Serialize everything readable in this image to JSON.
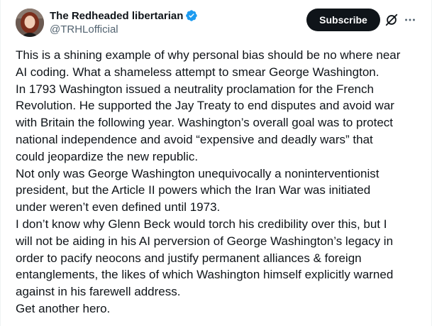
{
  "author": {
    "display_name": "The Redheaded libertarian",
    "handle": "@TRHLofficial",
    "verified": true,
    "avatar_icon": "profile-photo"
  },
  "actions": {
    "subscribe_label": "Subscribe",
    "grok_icon": "grok-slash-circle-icon",
    "more_icon": "ellipsis-icon"
  },
  "colors": {
    "verified_blue": "#1d9bf0",
    "text_primary": "#0f1419",
    "text_secondary": "#536471",
    "button_bg": "#0f1419"
  },
  "post": {
    "lines": [
      "This is a shining example of why personal bias should be no where near",
      "AI coding. What a shameless attempt to smear George Washington.",
      "In 1793 Washington issued a neutrality proclamation for the French",
      "Revolution. He supported the Jay Treaty to end disputes and avoid war",
      "with Britain the following year. Washington’s overall goal was to protect",
      "national independence and avoid “expensive and deadly wars” that",
      "could jeopardize the new republic.",
      "Not only was George Washington unequivocally a noninterventionist",
      "president, but the Article II powers which the Iran War was initiated",
      "under weren’t even defined until 1973.",
      "I don’t know why Glenn Beck would torch his credibility over this, but I",
      "will not be aiding in his AI perversion of George Washington’s legacy in",
      "order to pacify neocons and justify permanent alliances & foreign",
      "entanglements, the likes of which Washington himself explicitly warned",
      "against in his farewell address.",
      "Get another hero."
    ]
  }
}
